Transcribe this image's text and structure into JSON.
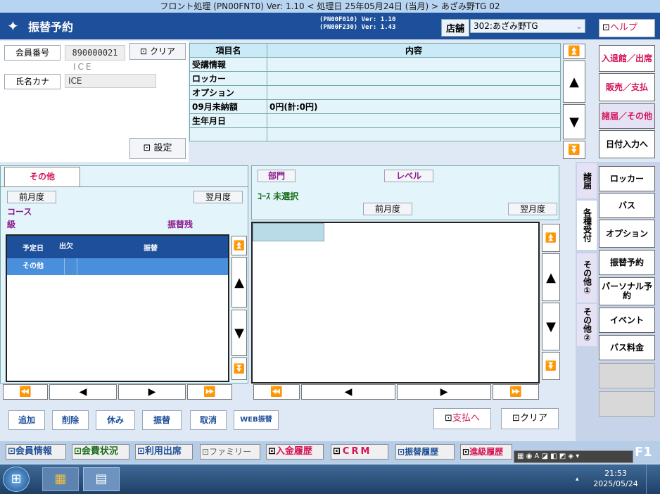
{
  "window_title": "フロント処理 (PN00FNT0) Ver: 1.10 < 処理日 25年05月24日 (当月) > あざみ野TG 02",
  "app": {
    "title": "振替予約",
    "ver1": "(PN00F010) Ver: 1.10",
    "ver2": "(PN00F230) Ver: 1.43",
    "store_label": "店舗",
    "store_value": "302:あざみ野TG",
    "help": "ヘルプ"
  },
  "member": {
    "no_label": "会員番号",
    "no_value": "890000021",
    "clear": "クリア",
    "sub": "ICE",
    "kana_label": "氏名カナ",
    "kana_value": "ICE",
    "settings": "設定"
  },
  "info": {
    "col1": "項目名",
    "col2": "内容",
    "rows": [
      {
        "k": "受講情報",
        "v": ""
      },
      {
        "k": "ロッカー",
        "v": ""
      },
      {
        "k": "オプション",
        "v": ""
      },
      {
        "k": "09月未納額",
        "v": "0円(計:0円)"
      },
      {
        "k": "生年月日",
        "v": ""
      },
      {
        "k": "",
        "v": ""
      }
    ]
  },
  "left": {
    "tab": "その他",
    "prev": "前月度",
    "next": "翌月度",
    "course": "コース",
    "grade": "級",
    "remaining": "振替残",
    "h_date": "予定日",
    "h_att": "出欠",
    "h_furi": "振替",
    "row1": "その他"
  },
  "middle": {
    "dept": "部門",
    "level": "レベル",
    "course": "ｺｰｽ 未選択",
    "prev": "前月度",
    "next": "翌月度"
  },
  "actions": [
    "追加",
    "削除",
    "休み",
    "振替",
    "取消",
    "WEB振替"
  ],
  "pay": "支払へ",
  "clear2": "クリア",
  "right_top": [
    "入退館／出席",
    "販売／支払",
    "諸届／その他",
    "日付入力へ"
  ],
  "vtabs": [
    "諸届",
    "各種受付",
    "その他①",
    "その他②"
  ],
  "right_btns": [
    "ロッカー",
    "バス",
    "オプション",
    "振替予約",
    "パーソナル予約",
    "イベント",
    "バス料金"
  ],
  "bottom": [
    "会員情報",
    "会費状況",
    "利用出席",
    "ファミリー",
    "入金履歴",
    "CRM",
    "振替履歴",
    "進級履歴"
  ],
  "f1": "F1",
  "clock": {
    "time": "21:53",
    "date": "2025/05/24"
  },
  "colors": {
    "header": "#1e4f9a",
    "panel": "#e3f5fb",
    "select": "#4a8fdc",
    "red": "#d4145a"
  }
}
